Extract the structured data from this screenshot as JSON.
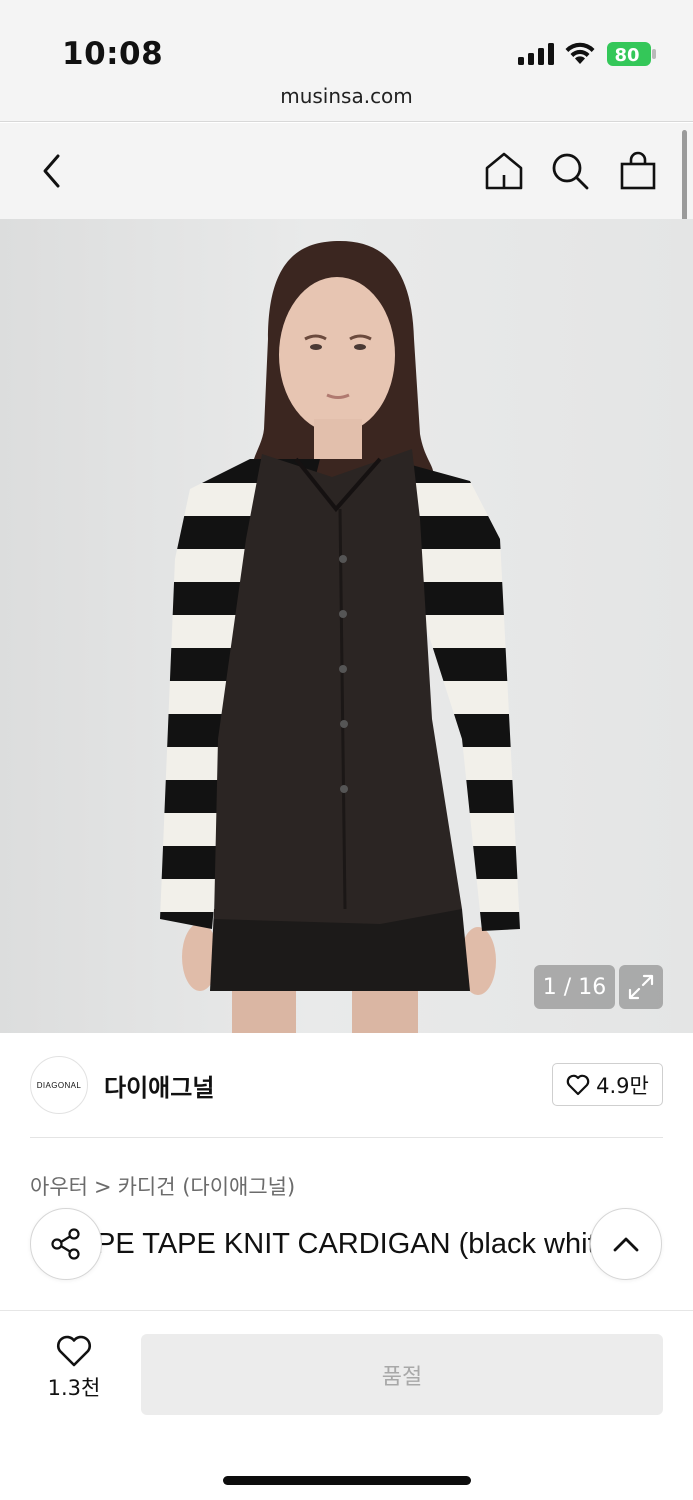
{
  "status": {
    "time": "10:08",
    "battery": "80"
  },
  "browser": {
    "url": "musinsa.com"
  },
  "nav": {
    "back_icon": "chevron-left-icon",
    "home_icon": "home-icon",
    "search_icon": "search-icon",
    "cart_icon": "shopping-bag-icon"
  },
  "gallery": {
    "counter": "1 / 16",
    "expand_icon": "expand-icon"
  },
  "brand": {
    "logo_text": "DIAGONAL",
    "name": "다이애그널",
    "likes": "4.9만"
  },
  "breadcrumb": {
    "level1": "아우터",
    "separator": ">",
    "level2": "카디건 (다이애그널)"
  },
  "product": {
    "title": "STRIPE TAPE KNIT CARDIGAN (black white)"
  },
  "bottom": {
    "wish_count": "1.3천",
    "action_label": "품절"
  },
  "colors": {
    "accent_green": "#34c759",
    "soldout_bg": "#ececec"
  }
}
